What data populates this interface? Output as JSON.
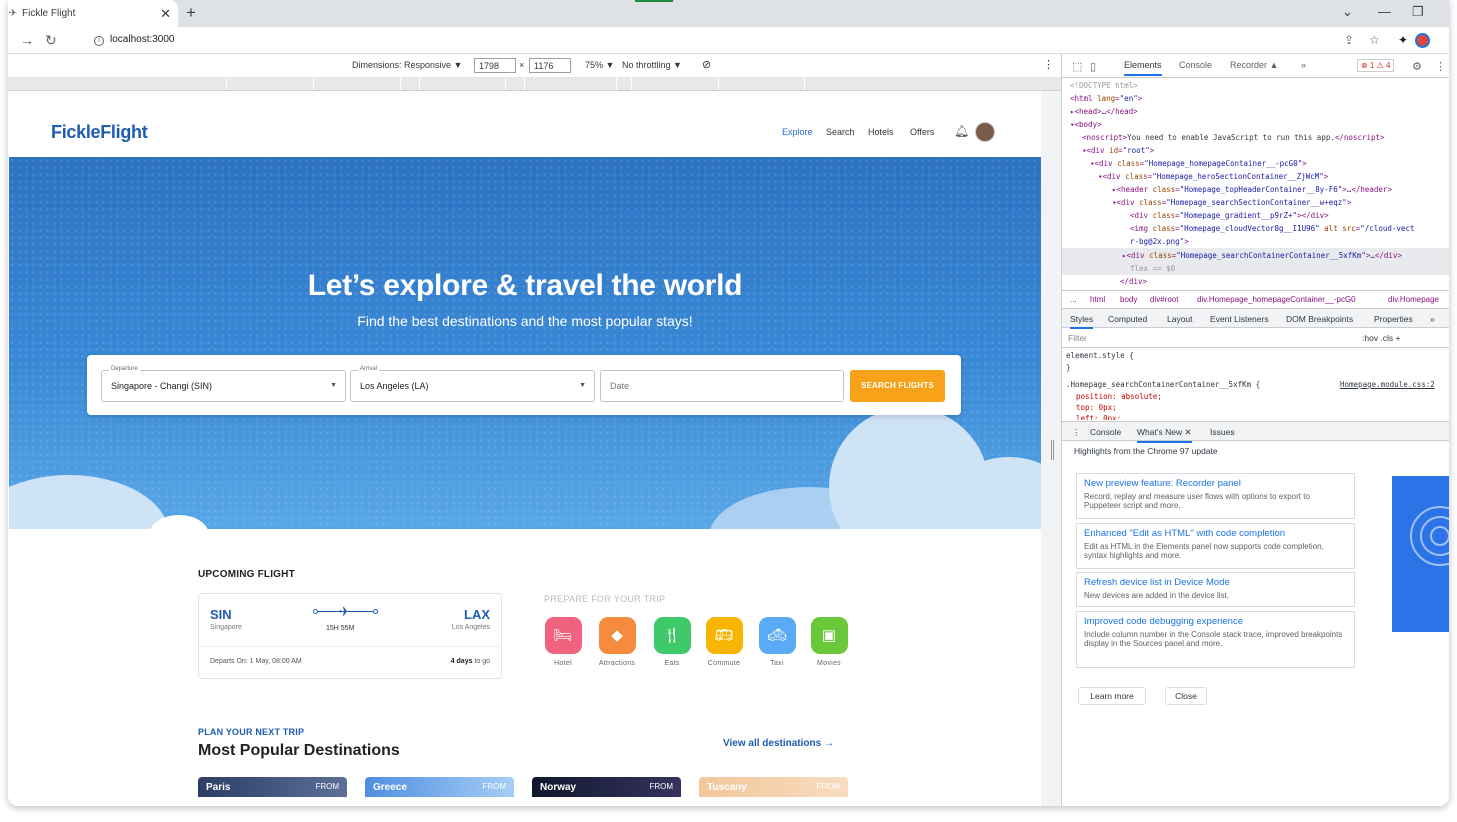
{
  "browser": {
    "tab_title": "Fickle Flight",
    "tab_close": "✕",
    "new_tab": "+",
    "url": "localhost:3000",
    "win_min": "—",
    "win_max": "❐",
    "win_close": "✕",
    "tab_menu": "⌄"
  },
  "device_toolbar": {
    "dimensions": "Dimensions: Responsive ▼",
    "width": "1798",
    "times": "×",
    "height": "1176",
    "zoom": "75% ▼",
    "throttle": "No throttling ▼"
  },
  "site": {
    "logo": "FickleFlight",
    "nav": [
      "Explore",
      "Search",
      "Hotels",
      "Offers"
    ],
    "hero_title": "Let’s explore & travel the world",
    "hero_subtitle": "Find the best destinations and the most popular stays!",
    "search": {
      "departure_label": "Departure",
      "departure_value": "Singapore -  Changi (SIN)",
      "arrival_label": "Arrival",
      "arrival_value": "Los Angeles (LA)",
      "date_placeholder": "Date",
      "button": "SEARCH FLIGHTS"
    },
    "upcoming": {
      "title": "UPCOMING FLIGHT",
      "from_code": "SIN",
      "from_city": "Singapore",
      "to_code": "LAX",
      "to_city": "Los Angeles",
      "duration": "15H 55M",
      "departs": "Departs On: 1 May, 08:00 AM",
      "days": "4 days",
      "days_suffix": " to go"
    },
    "prepare": {
      "title": "PREPARE FOR YOUR TRIP",
      "items": [
        {
          "label": "Hotel",
          "color": "#f0637f"
        },
        {
          "label": "Attractions",
          "color": "#f58b3c"
        },
        {
          "label": "Eats",
          "color": "#3ec96a"
        },
        {
          "label": "Commute",
          "color": "#f7b500"
        },
        {
          "label": "Taxi",
          "color": "#5aaaf5"
        },
        {
          "label": "Movies",
          "color": "#6ac93a"
        }
      ]
    },
    "plan": {
      "subtitle": "PLAN YOUR NEXT TRIP",
      "title": "Most Popular Destinations",
      "view_all": "View all destinations →",
      "destinations": [
        {
          "name": "Paris",
          "from": "FROM"
        },
        {
          "name": "Greece",
          "from": "FROM"
        },
        {
          "name": "Norway",
          "from": "FROM"
        },
        {
          "name": "Tuscany",
          "from": "FROM"
        }
      ]
    }
  },
  "devtools": {
    "tabs": [
      "Elements",
      "Console",
      "Recorder ▲",
      "»"
    ],
    "errors": "⊗ 1 ⚠ 4",
    "breadcrumbs": [
      "...",
      "html",
      "body",
      "div#root",
      "div.Homepage_homepageContainer__-pcG0",
      "div.Homepage"
    ],
    "style_tabs": [
      "Styles",
      "Computed",
      "Layout",
      "Event Listeners",
      "DOM Breakpoints",
      "Properties",
      "»"
    ],
    "filter_placeholder": "Filter",
    "filter_tools": ":hov  .cls  +",
    "css_element_style": "element.style {",
    "css_close": "}",
    "css_selector": ".Homepage_searchContainerContainer__5xfKm {",
    "css_source": "Homepage.module.css:2",
    "css_prop1": "position: absolute;",
    "css_prop2": "top: 0px;",
    "css_prop3": "left: 0px;",
    "drawer_tabs": [
      "Console",
      "What's New ✕",
      "Issues"
    ],
    "whats_new_header": "Highlights from the Chrome 97 update",
    "cards": [
      {
        "title": "New preview feature: Recorder panel",
        "desc": "Record, replay and measure user flows with options to export to Puppeteer script and more."
      },
      {
        "title": "Enhanced \"Edit as HTML\" with code completion",
        "desc": "Edit as HTML in the Elements panel now supports code completion, syntax highlights and more."
      },
      {
        "title": "Refresh device list in Device Mode",
        "desc": "New devices are added in the device list."
      },
      {
        "title": "Improved code debugging experience",
        "desc": "Include column number in the Console stack trace, improved breakpoints display in the Sources panel and more."
      }
    ],
    "learn_more": "Learn more",
    "close": "Close"
  }
}
